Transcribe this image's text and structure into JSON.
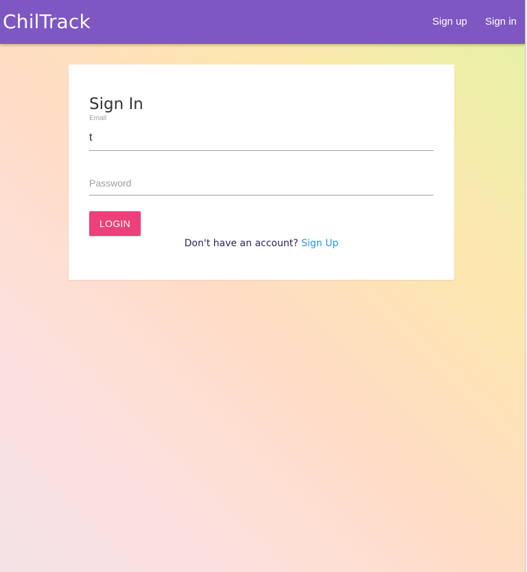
{
  "navbar": {
    "brand": "ChilTrack",
    "links": [
      {
        "label": "Sign up"
      },
      {
        "label": "Sign in"
      }
    ],
    "color": "#7e57c2"
  },
  "signin_card": {
    "title": "Sign In",
    "email": {
      "label": "Email",
      "value": "t"
    },
    "password": {
      "placeholder": "Password",
      "value": ""
    },
    "login_button": {
      "label": "LOGIN",
      "color": "#ec407a"
    },
    "signup_prompt": "Don't have an account?",
    "signup_link": "Sign Up",
    "link_color": "#2196f3"
  }
}
